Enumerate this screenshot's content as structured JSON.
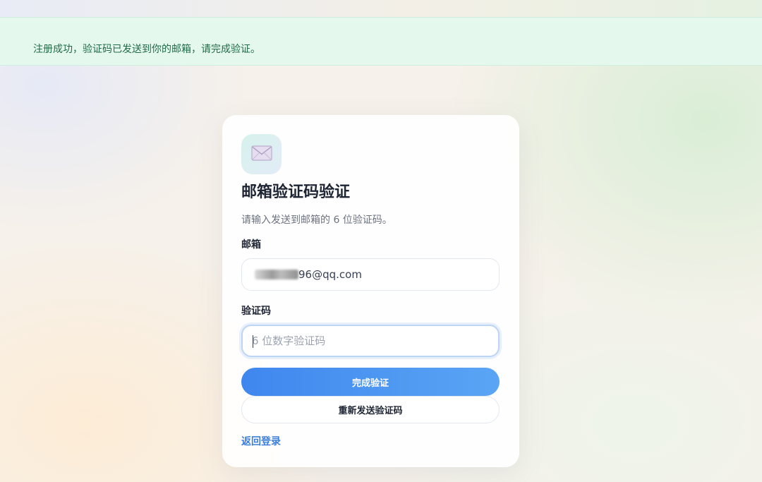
{
  "banner": {
    "message": "注册成功，验证码已发送到你的邮箱，请完成验证。"
  },
  "card": {
    "icon": "envelope-icon",
    "title": "邮箱验证码验证",
    "subtitle": "请输入发送到邮箱的 6 位验证码。",
    "email": {
      "label": "邮箱",
      "value_visible_suffix": "96@qq.com"
    },
    "code": {
      "label": "验证码",
      "placeholder": "6 位数字验证码",
      "value": ""
    },
    "submit_label": "完成验证",
    "resend_label": "重新发送验证码",
    "back_link_label": "返回登录"
  },
  "colors": {
    "accent": "#3f87ee",
    "success_bg": "#e5f8ee",
    "success_text": "#1f6b46",
    "link": "#3d7fd8"
  }
}
